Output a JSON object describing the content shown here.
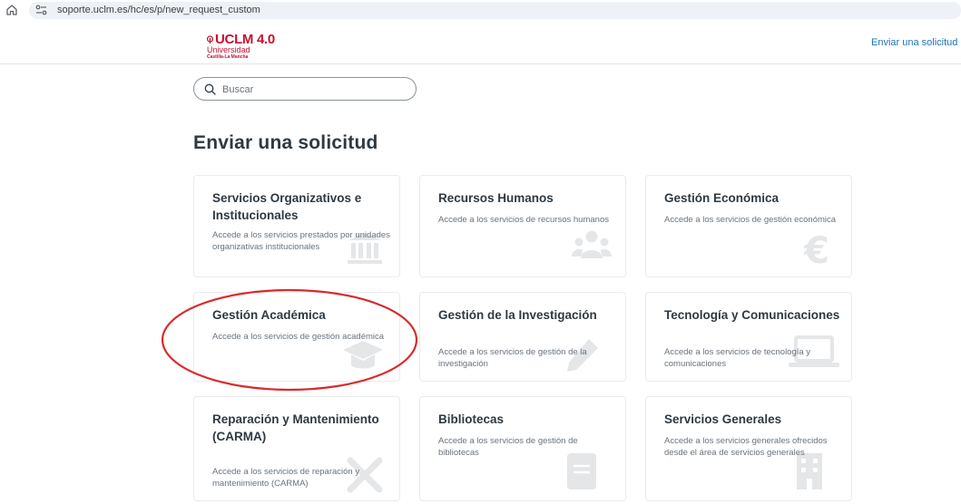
{
  "browser": {
    "url": "soporte.uclm.es/hc/es/p/new_request_custom"
  },
  "header": {
    "logo_main": "UCLM 4.0",
    "logo_sub1": "Universidad",
    "logo_sub2": "Castilla-La Mancha",
    "nav_link": "Enviar una solicitud"
  },
  "search": {
    "placeholder": "Buscar"
  },
  "page": {
    "title": "Enviar una solicitud"
  },
  "colors": {
    "brand": "#c8102e",
    "link": "#1f73b7",
    "annotation": "#d92b2b"
  },
  "cards": [
    {
      "title": "Servicios Organizativos e Institucionales",
      "description": "Accede a los servicios prestados por unidades organizativas institucionales",
      "icon": "institution-icon"
    },
    {
      "title": "Recursos Humanos",
      "description": "Accede a los servicios de recursos humanos",
      "icon": "people-icon"
    },
    {
      "title": "Gestión Económica",
      "description": "Accede a los servicios de gestión económica",
      "icon": "euro-icon"
    },
    {
      "title": "Gestión Académica",
      "description": "Accede a los servicios de gestión académica",
      "icon": "graduation-cap-icon"
    },
    {
      "title": "Gestión de la Investigación",
      "description": "Accede a los servicios de gestión de la investigación",
      "icon": "pen-icon"
    },
    {
      "title": "Tecnología y Comunicaciones",
      "description": "Accede a los servicios de tecnología y comunicaciones",
      "icon": "laptop-icon"
    },
    {
      "title": "Reparación y Mantenimiento (CARMA)",
      "description": "Accede a los servicios de reparación y mantenimiento (CARMA)",
      "icon": "tools-icon"
    },
    {
      "title": "Bibliotecas",
      "description": "Accede a los servicios de gestión de bibliotecas",
      "icon": "book-icon"
    },
    {
      "title": "Servicios Generales",
      "description": "Accede a los servicios generales ofrecidos desde el área de servicios generales",
      "icon": "building-icon"
    }
  ]
}
